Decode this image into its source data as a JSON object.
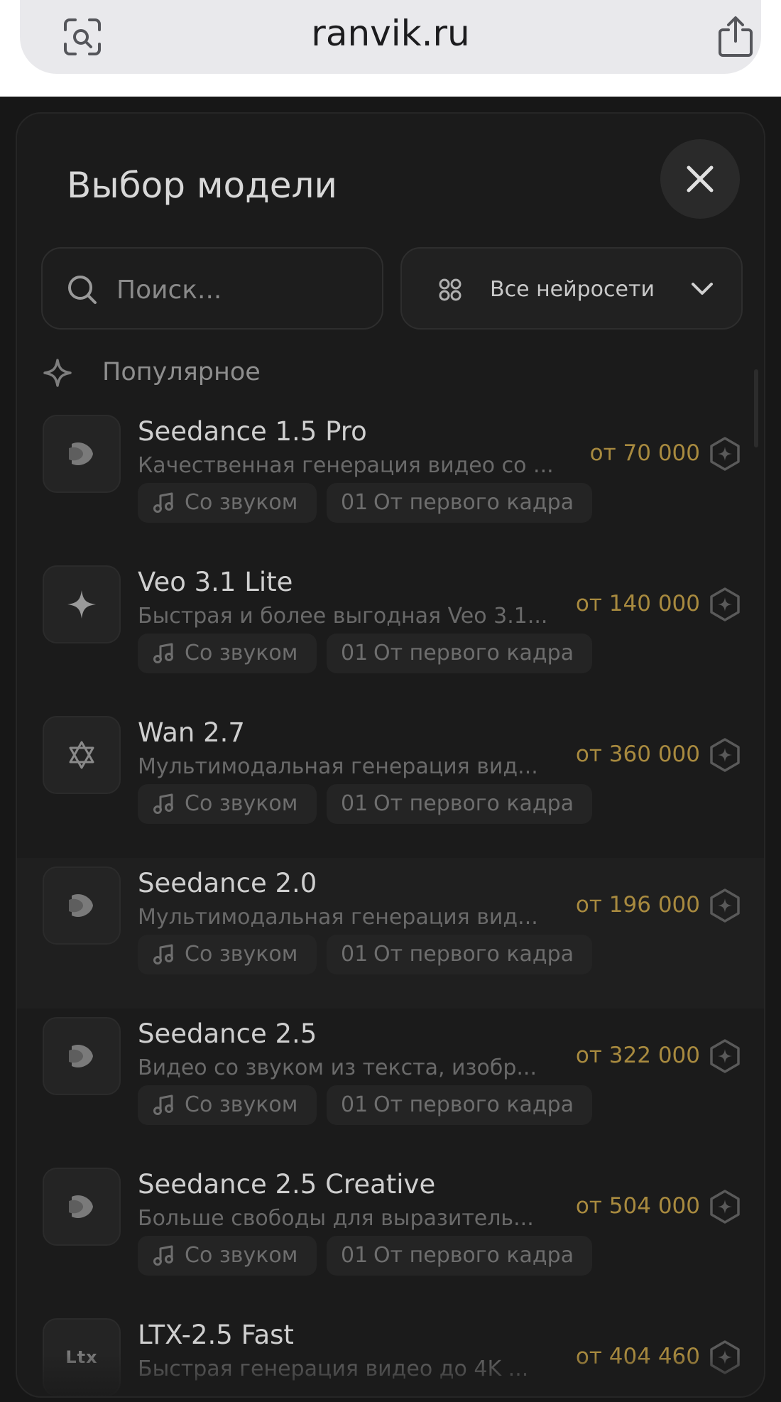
{
  "browser": {
    "url": "ranvik.ru",
    "left_icon": "scan-icon",
    "right_icon": "share-icon"
  },
  "modal": {
    "title": "Выбор модели",
    "close_icon": "close-icon",
    "search": {
      "placeholder": "Поиск...",
      "value": ""
    },
    "filter": {
      "label": "Все нейросети",
      "icon": "grid-icon"
    },
    "section": {
      "label": "Популярное",
      "icon": "sparkle-icon"
    }
  },
  "colors": {
    "background": "#171717",
    "modal": "#1b1b1b",
    "price": "#a88a3f",
    "muted_text": "#6a6a6a"
  },
  "tags": {
    "sound": "Со звуком",
    "frame_code": "01",
    "frame": "От первого кадра"
  },
  "models": [
    {
      "name": "Seedance 1.5 Pro",
      "desc": "Качественная генерация видео со ...",
      "price": "от 70 000",
      "icon": "seedance-logo-icon"
    },
    {
      "name": "Veo 3.1 Lite",
      "desc": "Быстрая и более выгодная Veo 3.1...",
      "price": "от 140 000",
      "icon": "sparkle-logo-icon"
    },
    {
      "name": "Wan 2.7",
      "desc": "Мультимодальная генерация вид...",
      "price": "от 360 000",
      "icon": "wan-logo-icon"
    },
    {
      "name": "Seedance 2.0",
      "desc": "Мультимодальная генерация вид...",
      "price": "от 196 000",
      "icon": "seedance-logo-icon"
    },
    {
      "name": "Seedance 2.5",
      "desc": "Видео со звуком из текста, изобр...",
      "price": "от 322 000",
      "icon": "seedance-logo-icon"
    },
    {
      "name": "Seedance 2.5 Creative",
      "desc": "Больше свободы для выразитель...",
      "price": "от 504 000",
      "icon": "seedance-logo-icon"
    },
    {
      "name": "LTX-2.5 Fast",
      "desc": "Быстрая генерация видео до 4K ...",
      "price": "от 404 460",
      "icon": "ltx-logo-icon",
      "logo_text": "Ltx"
    }
  ]
}
